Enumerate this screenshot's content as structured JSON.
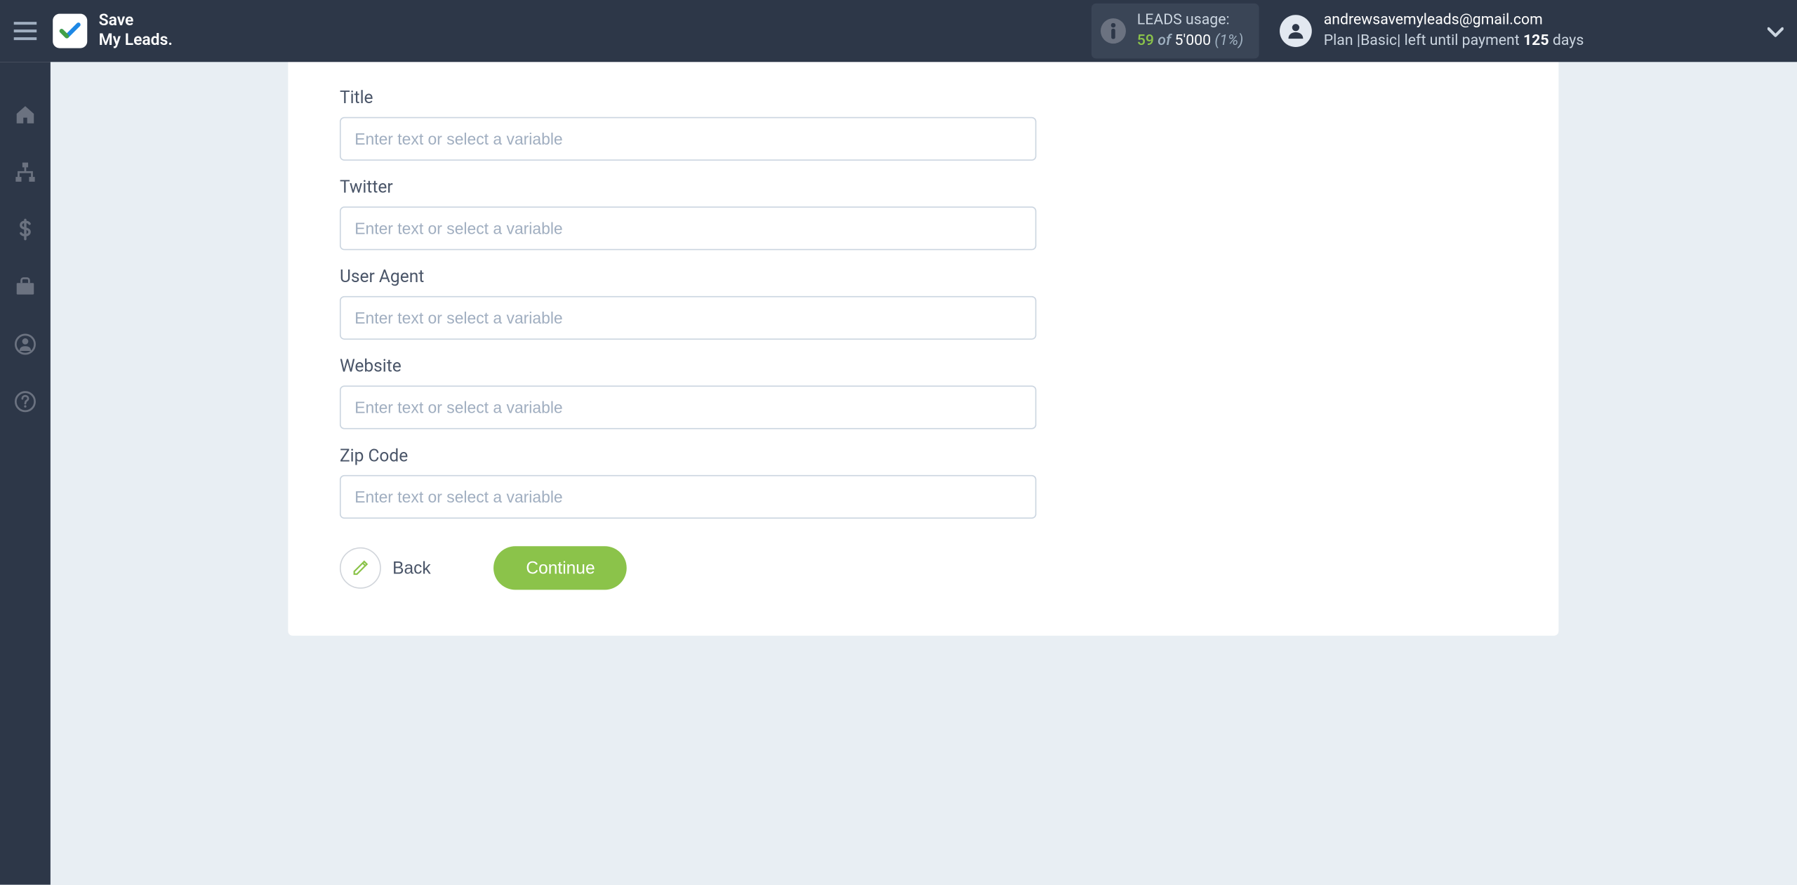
{
  "header": {
    "logo_line1": "Save",
    "logo_line2": "My Leads."
  },
  "leads_usage": {
    "title": "LEADS usage:",
    "used": "59",
    "of_word": "of",
    "total": "5'000",
    "percent": "(1%)"
  },
  "account": {
    "email": "andrewsavemyleads@gmail.com",
    "plan_prefix": "Plan |",
    "plan_name": "Basic",
    "plan_suffix": "| left until payment",
    "days_count": "125",
    "days_word": "days"
  },
  "form": {
    "placeholder": "Enter text or select a variable",
    "fields": [
      {
        "label": "Title"
      },
      {
        "label": "Twitter"
      },
      {
        "label": "User Agent"
      },
      {
        "label": "Website"
      },
      {
        "label": "Zip Code"
      }
    ]
  },
  "buttons": {
    "back": "Back",
    "continue": "Continue"
  }
}
